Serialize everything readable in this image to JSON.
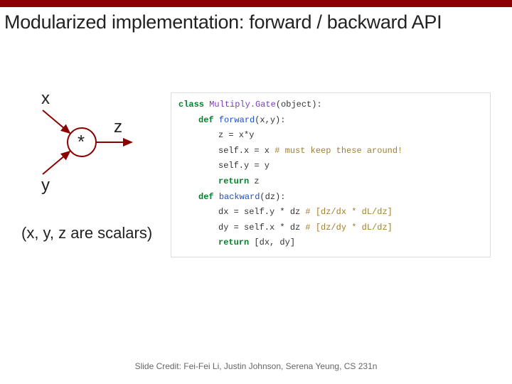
{
  "title": "Modularized implementation: forward / backward API",
  "diagram": {
    "x_label": "x",
    "y_label": "y",
    "z_label": "z",
    "op": "*"
  },
  "scalars_note": "(x, y, z are scalars)",
  "code": {
    "c0a": "class",
    "c0b": "Multiply.Gate",
    "c0c": "(object):",
    "c1a": "def",
    "c1b": "forward",
    "c1c": "(x,y):",
    "c2": "z = x*y",
    "c3a": "self.x = x ",
    "c3b": "# must keep these around!",
    "c4": "self.y = y",
    "c5a": "return",
    "c5b": " z",
    "c6a": "def",
    "c6b": "backward",
    "c6c": "(dz):",
    "c7a": "dx = self.y * dz ",
    "c7b": "# [dz/dx * dL/dz]",
    "c8a": "dy = self.x * dz ",
    "c8b": "# [dz/dy * dL/dz]",
    "c9a": "return",
    "c9b": " [dx, dy]"
  },
  "footer": "Slide Credit: Fei-Fei Li, Justin Johnson, Serena Yeung, CS 231n"
}
